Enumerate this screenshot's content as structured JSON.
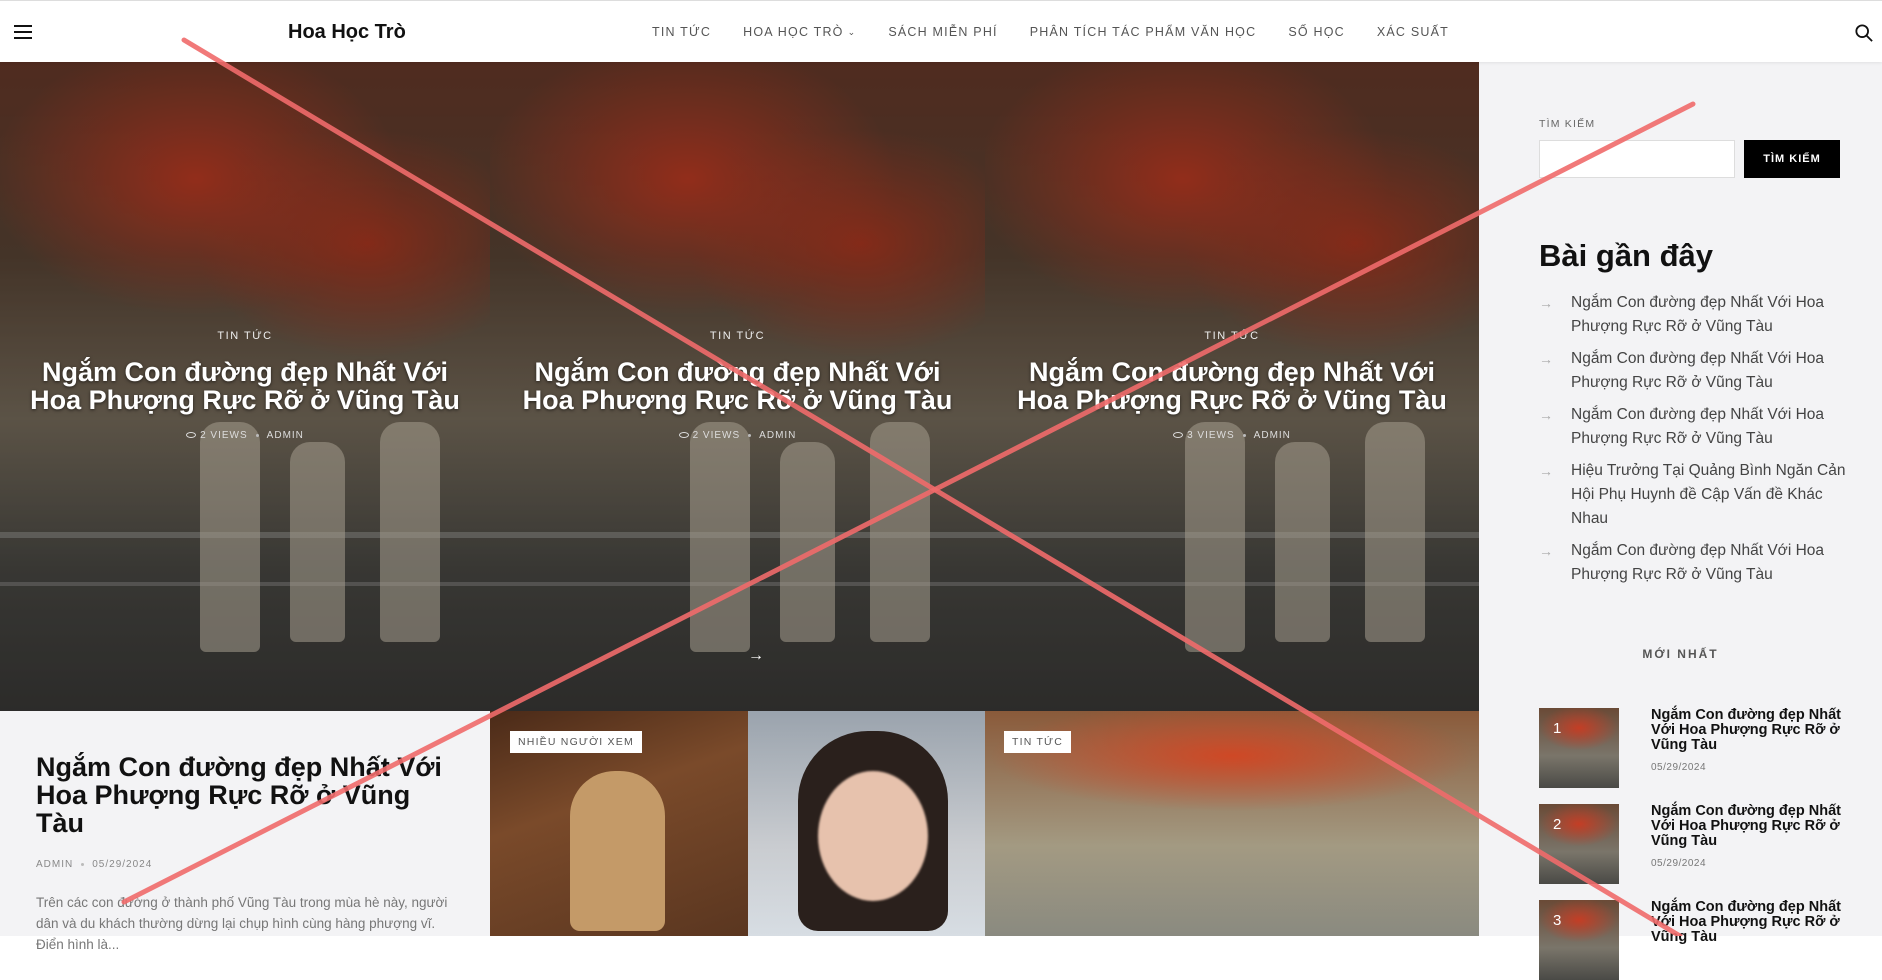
{
  "header": {
    "site_title": "Hoa Học Trò",
    "nav": [
      {
        "label": "TIN TỨC"
      },
      {
        "label": "HOA HỌC TRÒ",
        "has_dropdown": true
      },
      {
        "label": "SÁCH MIỄN PHÍ"
      },
      {
        "label": "PHÂN TÍCH TÁC PHẨM VĂN HỌC"
      },
      {
        "label": "SỐ HỌC"
      },
      {
        "label": "XÁC SUẤT"
      }
    ],
    "icons": {
      "menu": "hamburger-icon",
      "search": "search-icon"
    }
  },
  "hero": {
    "slides": [
      {
        "category": "TIN TỨC",
        "title": "Ngắm Con đường đẹp Nhất Với Hoa Phượng Rực Rỡ ở Vũng Tàu",
        "views": "2 VIEWS",
        "author": "ADMIN"
      },
      {
        "category": "TIN TỨC",
        "title": "Ngắm Con đường đẹp Nhất Với Hoa Phượng Rực Rỡ ở Vũng Tàu",
        "views": "2 VIEWS",
        "author": "ADMIN"
      },
      {
        "category": "TIN TỨC",
        "title": "Ngắm Con đường đẹp Nhất Với Hoa Phượng Rực Rỡ ở Vũng Tàu",
        "views": "3 VIEWS",
        "author": "ADMIN"
      }
    ],
    "arrow": "→"
  },
  "feature_post": {
    "title": "Ngắm Con đường đẹp Nhất Với Hoa Phượng Rực Rỡ ở Vũng Tàu",
    "author": "ADMIN",
    "date": "05/29/2024",
    "excerpt": "Trên các con đường ở thành phố Vũng Tàu trong mùa hè này, người dân và du khách thường dừng lại chụp hình cùng hàng phượng vĩ. Điển hình là..."
  },
  "tiles": [
    {
      "label": "NHIỀU NGƯỜI XEM"
    },
    {
      "label": "TIN TỨC"
    }
  ],
  "sidebar": {
    "search_label": "TÌM KIẾM",
    "search_value": "",
    "search_button": "TÌM KIẾM",
    "recent_heading": "Bài gần đây",
    "recent": [
      "Ngắm Con đường đẹp Nhất Với Hoa Phượng Rực Rỡ ở Vũng Tàu",
      "Ngắm Con đường đẹp Nhất Với Hoa Phượng Rực Rỡ ở Vũng Tàu",
      "Ngắm Con đường đẹp Nhất Với Hoa Phượng Rực Rỡ ở Vũng Tàu",
      "Hiệu Trưởng Tại Quảng Bình Ngăn Cản Hội Phụ Huynh đề Cập Vấn đề Khác Nhau",
      "Ngắm Con đường đẹp Nhất Với Hoa Phượng Rực Rỡ ở Vũng Tàu"
    ],
    "newest_heading": "MỚI NHẤT",
    "newest": [
      {
        "num": "1",
        "title": "Ngắm Con đường đẹp Nhất Với Hoa Phượng Rực Rỡ ở Vũng Tàu",
        "date": "05/29/2024"
      },
      {
        "num": "2",
        "title": "Ngắm Con đường đẹp Nhất Với Hoa Phượng Rực Rỡ ở Vũng Tàu",
        "date": "05/29/2024"
      },
      {
        "num": "3",
        "title": "Ngắm Con đường đẹp Nhất Với Hoa Phượng Rực Rỡ ở Vũng Tàu",
        "date": ""
      }
    ]
  },
  "colors": {
    "accent": "#000000",
    "cross": "#f06b6b",
    "sidebar_bg": "#f3f3f5"
  }
}
